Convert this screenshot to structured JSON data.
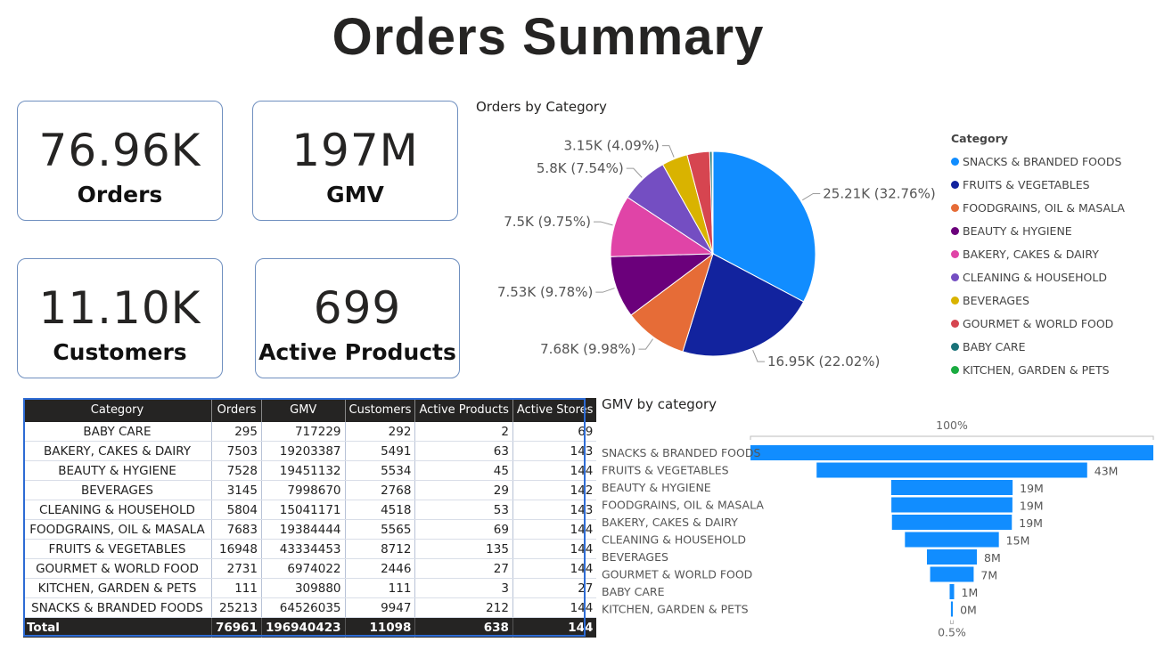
{
  "page_title": "Orders Summary",
  "kpis": {
    "orders": {
      "value": "76.96K",
      "label": "Orders"
    },
    "gmv": {
      "value": "197M",
      "label": "GMV"
    },
    "customers": {
      "value": "11.10K",
      "label": "Customers"
    },
    "active_products": {
      "value": "699",
      "label": "Active Products"
    }
  },
  "chart_data": [
    {
      "type": "pie",
      "title": "Orders by Category",
      "legend_title": "Category",
      "legend_position": "right",
      "categories": [
        "SNACKS & BRANDED FOODS",
        "FRUITS & VEGETABLES",
        "FOODGRAINS, OIL & MASALA",
        "BEAUTY & HYGIENE",
        "BAKERY, CAKES & DAIRY",
        "CLEANING & HOUSEHOLD",
        "BEVERAGES",
        "GOURMET & WORLD FOOD",
        "BABY CARE",
        "KITCHEN, GARDEN & PETS"
      ],
      "values": [
        25213,
        16948,
        7683,
        7528,
        7503,
        5804,
        3145,
        2731,
        295,
        111
      ],
      "colors": [
        "#118DFF",
        "#12239E",
        "#E66C37",
        "#6B007B",
        "#E044A7",
        "#744EC2",
        "#D9B300",
        "#D64550",
        "#197278",
        "#1AAB40"
      ],
      "data_labels": [
        "25.21K (32.76%)",
        "16.95K (22.02%)",
        "7.68K (9.98%)",
        "7.53K (9.78%)",
        "7.5K (9.75%)",
        "5.8K (7.54%)",
        "3.15K (4.09%)",
        "",
        "",
        ""
      ]
    },
    {
      "type": "funnel",
      "title": "GMV by category",
      "top_label": "100%",
      "bottom_label": "0.5%",
      "categories": [
        "SNACKS & BRANDED FOODS",
        "FRUITS & VEGETABLES",
        "BEAUTY & HYGIENE",
        "FOODGRAINS, OIL & MASALA",
        "BAKERY, CAKES & DAIRY",
        "CLEANING & HOUSEHOLD",
        "BEVERAGES",
        "GOURMET & WORLD FOOD",
        "BABY CARE",
        "KITCHEN, GARDEN & PETS"
      ],
      "values": [
        64526035,
        43334453,
        19451132,
        19384444,
        19203387,
        15041171,
        7998670,
        6974022,
        717229,
        309880
      ],
      "data_labels": [
        "",
        "43M",
        "19M",
        "19M",
        "19M",
        "15M",
        "8M",
        "7M",
        "1M",
        "0M"
      ],
      "color": "#118DFF"
    }
  ],
  "table": {
    "columns": [
      "Category",
      "Orders",
      "GMV",
      "Customers",
      "Active Products",
      "Active Stores"
    ],
    "rows": [
      [
        "BABY CARE",
        "295",
        "717229",
        "292",
        "2",
        "69"
      ],
      [
        "BAKERY, CAKES & DAIRY",
        "7503",
        "19203387",
        "5491",
        "63",
        "143"
      ],
      [
        "BEAUTY & HYGIENE",
        "7528",
        "19451132",
        "5534",
        "45",
        "144"
      ],
      [
        "BEVERAGES",
        "3145",
        "7998670",
        "2768",
        "29",
        "142"
      ],
      [
        "CLEANING & HOUSEHOLD",
        "5804",
        "15041171",
        "4518",
        "53",
        "143"
      ],
      [
        "FOODGRAINS, OIL & MASALA",
        "7683",
        "19384444",
        "5565",
        "69",
        "144"
      ],
      [
        "FRUITS & VEGETABLES",
        "16948",
        "43334453",
        "8712",
        "135",
        "144"
      ],
      [
        "GOURMET & WORLD FOOD",
        "2731",
        "6974022",
        "2446",
        "27",
        "144"
      ],
      [
        "KITCHEN, GARDEN & PETS",
        "111",
        "309880",
        "111",
        "3",
        "27"
      ],
      [
        "SNACKS & BRANDED FOODS",
        "25213",
        "64526035",
        "9947",
        "212",
        "144"
      ]
    ],
    "total": [
      "Total",
      "76961",
      "196940423",
      "11098",
      "638",
      "144"
    ]
  }
}
